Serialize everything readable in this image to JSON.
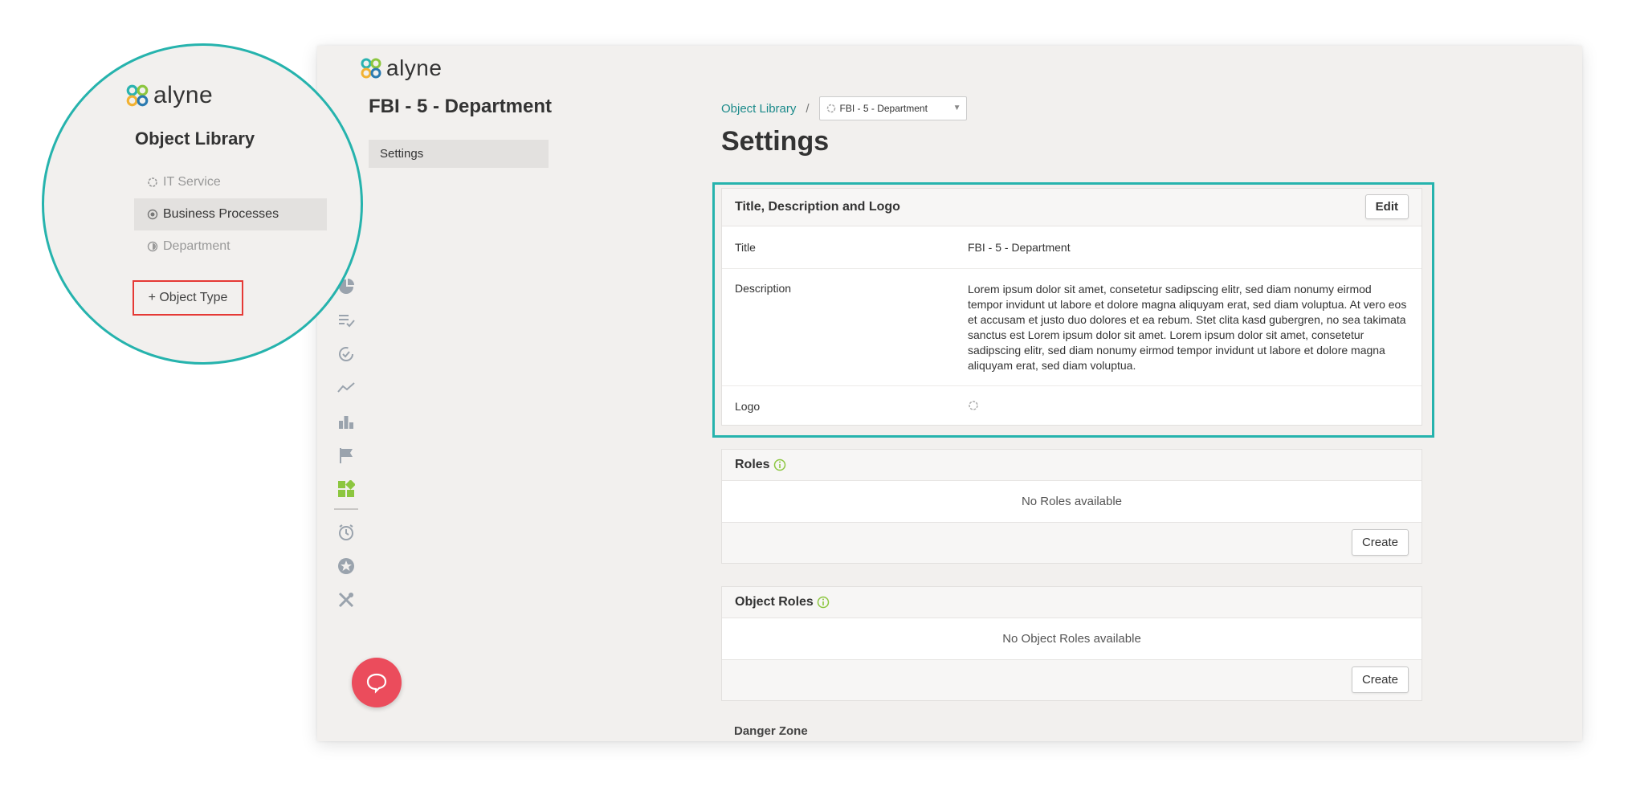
{
  "brand": {
    "name": "alyne"
  },
  "app": {
    "entity_title": "FBI - 5 - Department",
    "side_nav": [
      {
        "label": "Settings"
      }
    ]
  },
  "breadcrumb": {
    "link": "Object Library",
    "separator": "/",
    "selected": "FBI - 5 - Department"
  },
  "page_title": "Settings",
  "title_card": {
    "header": "Title, Description and Logo",
    "edit_label": "Edit",
    "rows": {
      "title_label": "Title",
      "title_value": "FBI - 5 - Department",
      "description_label": "Description",
      "description_value": "Lorem ipsum dolor sit amet, consetetur sadipscing elitr, sed diam nonumy eirmod tempor invidunt ut labore et dolore magna aliquyam erat, sed diam voluptua. At vero eos et accusam et justo duo dolores et ea rebum. Stet clita kasd gubergren, no sea takimata sanctus est Lorem ipsum dolor sit amet. Lorem ipsum dolor sit amet, consetetur sadipscing elitr, sed diam nonumy eirmod tempor invidunt ut labore et dolore magna aliquyam erat, sed diam voluptua.",
      "logo_label": "Logo"
    }
  },
  "roles_card": {
    "header": "Roles",
    "empty": "No Roles available",
    "create_label": "Create"
  },
  "object_roles_card": {
    "header": "Object Roles",
    "empty": "No Object Roles available",
    "create_label": "Create"
  },
  "danger_zone": {
    "header": "Danger Zone"
  },
  "zoom": {
    "title": "Object Library",
    "items": [
      {
        "label": "IT Service"
      },
      {
        "label": "Business Processes"
      },
      {
        "label": "Department"
      }
    ],
    "add_label": "+ Object Type"
  },
  "colors": {
    "accent_teal": "#26b3ad",
    "link_teal": "#1b8a8a",
    "info_green": "#8cc63f",
    "chat_red": "#eb4c5c",
    "highlight_red": "#e53935"
  }
}
